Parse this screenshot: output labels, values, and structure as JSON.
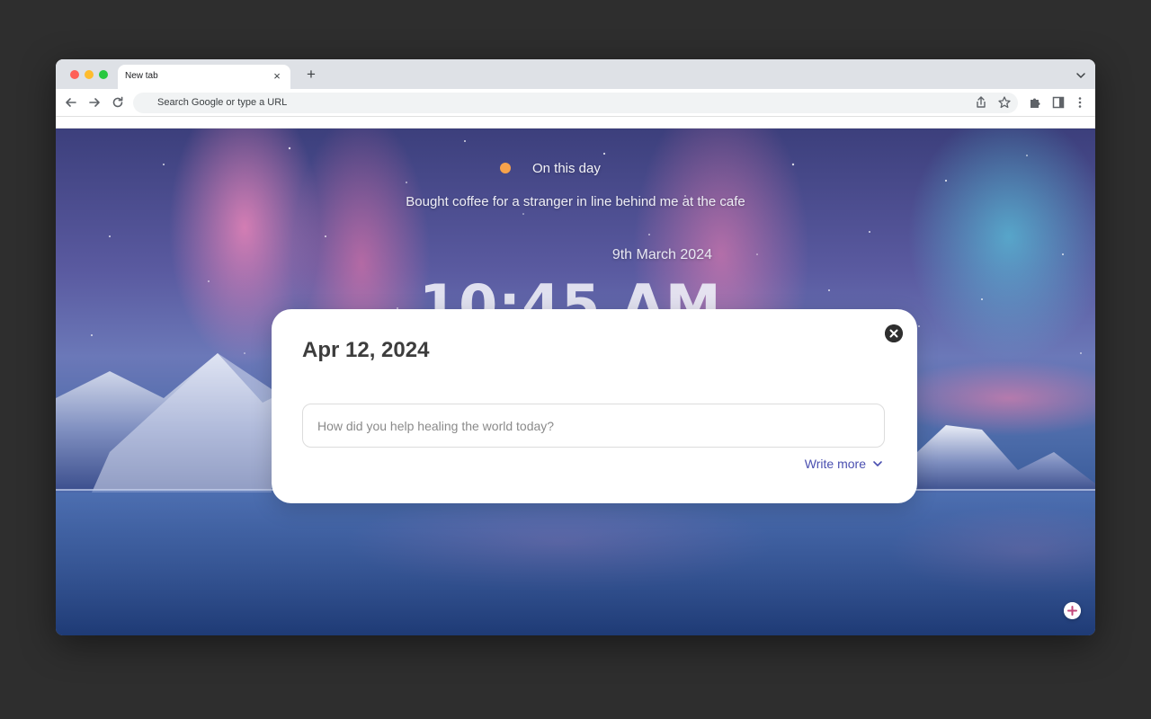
{
  "browser": {
    "tab_title": "New tab",
    "omnibox_placeholder": "Search Google or type a URL"
  },
  "on_this_day": {
    "label": "On this day",
    "entry_text": "Bought coffee for a stranger in line behind me at the cafe",
    "entry_date": "9th March 2024",
    "clock": "10:45 AM",
    "dot_color": "#f7a24b"
  },
  "journal_card": {
    "date": "Apr 12, 2024",
    "input_placeholder": "How did you help healing the world today?",
    "write_more_label": "Write more"
  },
  "icons": {
    "back": "arrow-left-icon",
    "forward": "arrow-right-icon",
    "reload": "reload-icon",
    "share": "share-icon",
    "bookmark": "star-icon",
    "extensions": "puzzle-icon",
    "side_panel": "side-panel-icon",
    "menu": "kebab-menu-icon",
    "close_card": "close-icon",
    "add": "plus-icon"
  },
  "colors": {
    "accent": "#4a4fb0",
    "desktop_bg": "#2e2e2e"
  }
}
